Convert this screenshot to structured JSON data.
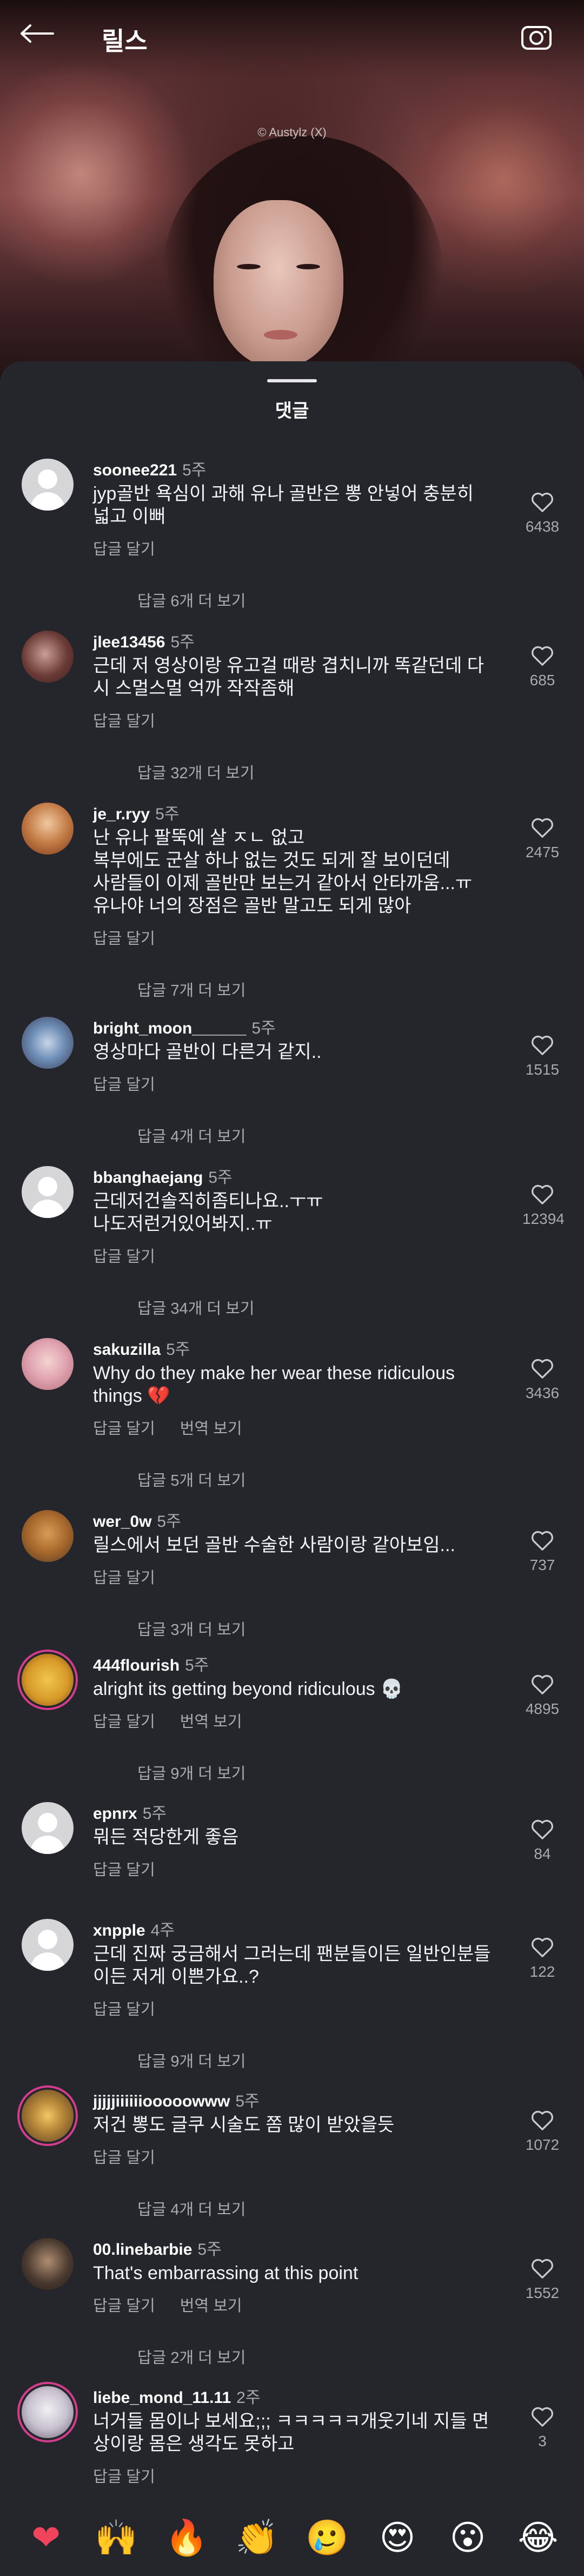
{
  "header": {
    "title": "릴스",
    "watermark": "© Austylz (X)"
  },
  "sheet": {
    "title": "댓글"
  },
  "labels": {
    "reply": "답글 달기",
    "translate": "번역 보기"
  },
  "comments": [
    {
      "username": "soonee221",
      "age": "5주",
      "text": "jyp골반 욕심이 과해 유나 골반은 뽕 안넣어 충분히 넓고 이뻐",
      "likes": "6438",
      "view_replies": "답글 6개 더 보기"
    },
    {
      "username": "jlee13456",
      "age": "5주",
      "text": "근데 저 영상이랑 유고걸 때랑 겹치니까 똑같던데 다시 스멀스멀 억까 작작좀해",
      "likes": "685",
      "view_replies": "답글 32개 더 보기"
    },
    {
      "username": "je_r.ryy",
      "age": "5주",
      "text": "난 유나 팔뚝에 살 ㅈㄴ 없고\n복부에도 군살 하나 없는 것도 되게 잘 보이던데\n사람들이 이제 골반만 보는거 같아서 안타까움...ㅠ\n유나야 너의 장점은 골반 말고도 되게 많아",
      "likes": "2475",
      "view_replies": "답글 7개 더 보기"
    },
    {
      "username": "bright_moon______",
      "age": "5주",
      "text": "영상마다 골반이 다른거 같지..",
      "likes": "1515",
      "view_replies": "답글 4개 더 보기"
    },
    {
      "username": "bbanghaejang",
      "age": "5주",
      "text": "근데저건솔직히좀티나요..ㅜㅠ\n나도저런거있어봐지..ㅠ",
      "likes": "12394",
      "view_replies": "답글 34개 더 보기"
    },
    {
      "username": "sakuzilla",
      "age": "5주",
      "text": "Why do they make her wear these ridiculous things 💔",
      "likes": "3436",
      "view_replies": "답글 5개 더 보기"
    },
    {
      "username": "wer_0w",
      "age": "5주",
      "text": "릴스에서 보던 골반 수술한 사람이랑 같아보임...",
      "likes": "737",
      "view_replies": "답글 3개 더 보기"
    },
    {
      "username": "444flourish",
      "age": "5주",
      "text": "alright its getting beyond ridiculous 💀",
      "likes": "4895",
      "view_replies": "답글 9개 더 보기"
    },
    {
      "username": "epnrx",
      "age": "5주",
      "text": "뭐든 적당한게 좋음",
      "likes": "84",
      "view_replies": ""
    },
    {
      "username": "xnpple",
      "age": "4주",
      "text": "근데 진짜 궁금해서 그러는데 팬분들이든 일반인분들이든 저게 이쁜가요..?",
      "likes": "122",
      "view_replies": "답글 9개 더 보기"
    },
    {
      "username": "jjjjjiiiiiiooooowww",
      "age": "5주",
      "text": "저건 뽕도 글쿠 시술도 쫌 많이 받았을듯",
      "likes": "1072",
      "view_replies": "답글 4개 더 보기"
    },
    {
      "username": "00.linebarbie",
      "age": "5주",
      "text": "That's embarrassing at this point",
      "likes": "1552",
      "view_replies": "답글 2개 더 보기"
    },
    {
      "username": "liebe_mond_11.11",
      "age": "2주",
      "text": "너거들 몸이나 보세요;;; ㅋㅋㅋㅋㅋ개웃기네 지들 면상이랑 몸은 생각도 못하고",
      "likes": "3",
      "view_replies": ""
    }
  ],
  "emoji_bar": [
    "❤",
    "🙌",
    "🔥",
    "👏",
    "🥲",
    "😍",
    "😮",
    "😂"
  ]
}
